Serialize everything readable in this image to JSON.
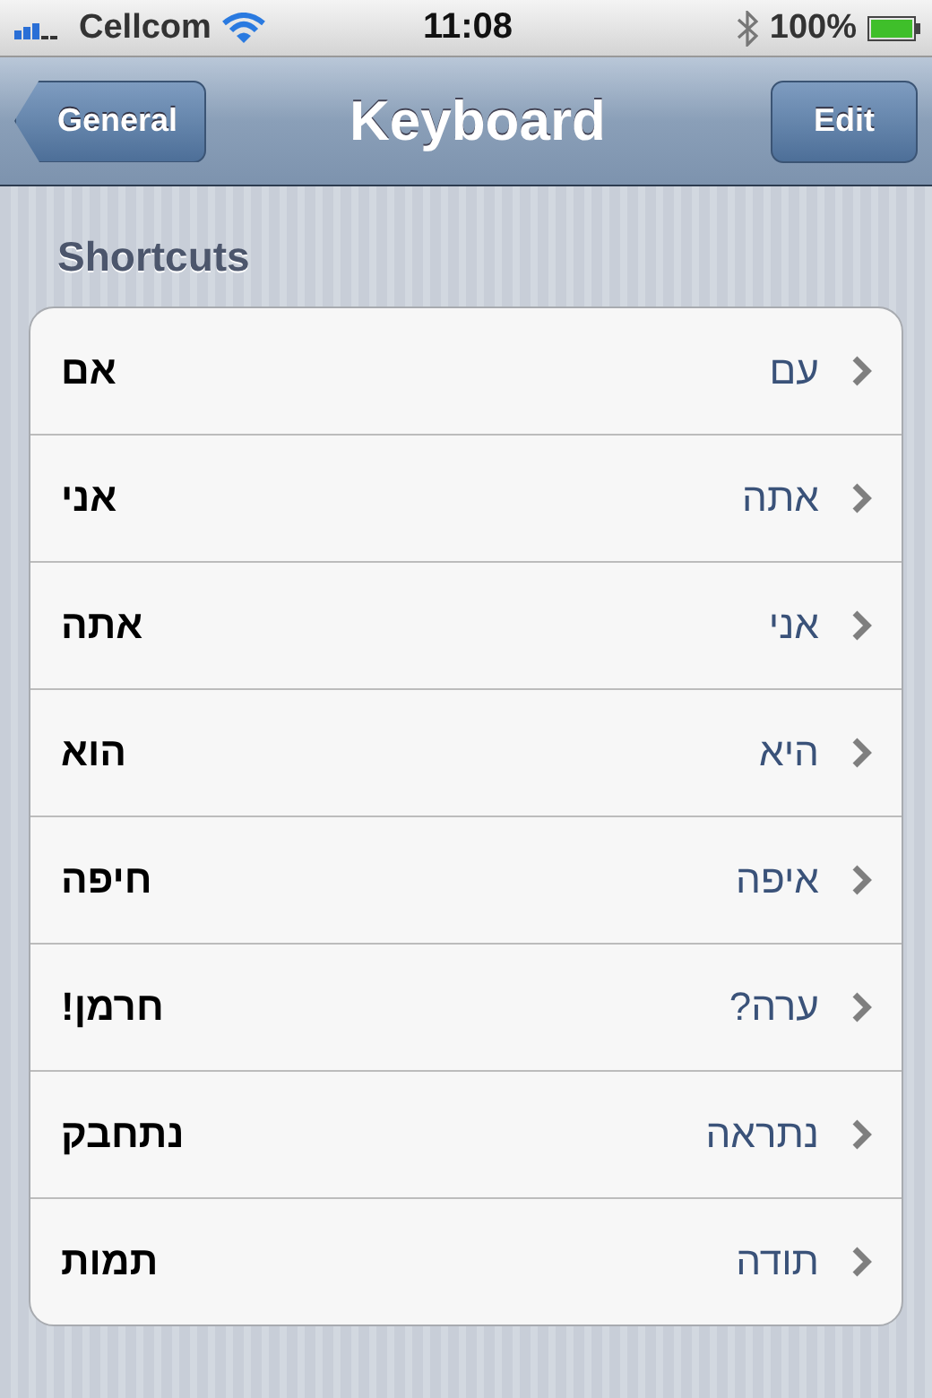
{
  "status_bar": {
    "carrier": "Cellcom",
    "time": "11:08",
    "battery": "100%"
  },
  "nav_bar": {
    "back": "General",
    "title": "Keyboard",
    "action": "Edit"
  },
  "section": {
    "header": "Shortcuts",
    "rows": [
      {
        "phrase": "אם",
        "shortcut": "עם"
      },
      {
        "phrase": "אני",
        "shortcut": "אתה"
      },
      {
        "phrase": "אתה",
        "shortcut": "אני"
      },
      {
        "phrase": "הוא",
        "shortcut": "היא"
      },
      {
        "phrase": "חיפה",
        "shortcut": "איפה"
      },
      {
        "phrase": "חרמן!",
        "shortcut": "ערה?"
      },
      {
        "phrase": "נתחבק",
        "shortcut": "נתראה"
      },
      {
        "phrase": "תמות",
        "shortcut": "תודה"
      }
    ]
  }
}
